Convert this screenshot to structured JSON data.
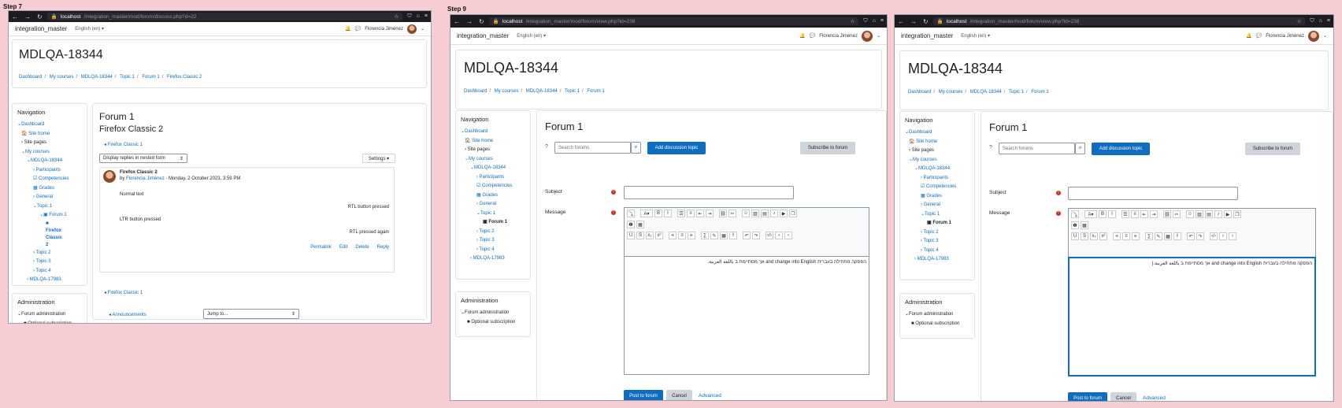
{
  "steps": {
    "s7": "Step 7",
    "s9": "Step 9"
  },
  "browser": {
    "url_left": {
      "host": "localhost",
      "path": "/integration_master/mod/forum/discuss.php?d=22"
    },
    "url_mid": {
      "host": "localhost",
      "path": "/integration_master/mod/forum/view.php?id=238"
    },
    "url_right": {
      "host": "localhost",
      "path": "/integration_master/mod/forum/view.php?id=238"
    }
  },
  "moodle": {
    "site_name": "integration_master",
    "lang": "English (en) ▾",
    "user": "Florencia Jiménez",
    "course_title": "MDLQA-18344",
    "crumbs_discuss": [
      "Dashboard",
      "My courses",
      "MDLQA-18344",
      "Topic 1",
      "Forum 1",
      "Firefox Classic 2"
    ],
    "crumbs_view": [
      "Dashboard",
      "My courses",
      "MDLQA-18344",
      "Topic 1",
      "Forum 1"
    ]
  },
  "nav": {
    "title": "Navigation",
    "items": [
      "Dashboard",
      "Site home",
      "Site pages",
      "My courses",
      "MDLQA-18344",
      "Participants",
      "Competencies",
      "Grades",
      "General",
      "Topic 1",
      "Forum 1",
      "Topic 2",
      "Topic 3",
      "Topic 4",
      "MDLQA-17983"
    ],
    "discussion_item": "Firefox Classic 2"
  },
  "admin": {
    "title": "Administration",
    "forum_admin": "Forum administration",
    "optional_sub": "Optional subscription"
  },
  "discuss": {
    "forum_title": "Forum 1",
    "discussion_title": "Firefox Classic 2",
    "prev_link": "◂ Firefox Classic 1",
    "next_link": "◂ Firefox Classic 1",
    "display_mode": "Display replies in nested form",
    "settings": "Settings ▾",
    "post_subject": "Firefox Classic 2",
    "post_by": "by",
    "post_author": "Florencia Jiménez",
    "post_date": "- Monday, 2 October 2023, 3:59 PM",
    "line1": "Normal text",
    "line2": "RTL button pressed",
    "line3": "LTR button pressed",
    "line4": "RTL pressed again",
    "actions": [
      "Permalink",
      "Edit",
      "Delete",
      "Reply"
    ],
    "announcements": "◂ Announcements",
    "jump_to": "Jump to..."
  },
  "form": {
    "forum_title": "Forum 1",
    "search_placeholder": "Search forums",
    "add_topic": "Add discussion topic",
    "subscribe": "Subscribe to forum",
    "subject_label": "Subject",
    "message_label": "Message",
    "message_text_mid": "הפסקה מתחילה בעברית and change into English אך מסתיימת ב باللغة العربية.",
    "message_text_right": "הפסקה מתחילה בעברית and change into English אך מסתיימת ב باللغة العربية.|",
    "post": "Post to forum",
    "cancel": "Cancel",
    "advanced": "Advanced"
  },
  "colors": {
    "primary": "#0f6cbf",
    "required": "#ca3120",
    "background": "#f6cdd3"
  }
}
